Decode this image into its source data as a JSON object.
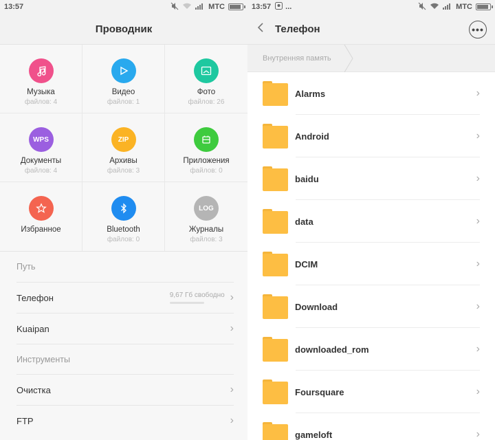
{
  "status_left": {
    "time": "13:57",
    "carrier": "МТС"
  },
  "status_right": {
    "time": "13:57",
    "carrier": "МТС",
    "notification_dots": "..."
  },
  "left": {
    "title": "Проводник",
    "categories": [
      {
        "label": "Музыка",
        "count": "файлов: 4",
        "color": "#f0518b",
        "icon": "music-icon",
        "glyph": "♫"
      },
      {
        "label": "Видео",
        "count": "файлов: 1",
        "color": "#29a9ee",
        "icon": "play-icon",
        "glyph": "▷"
      },
      {
        "label": "Фото",
        "count": "файлов: 26",
        "color": "#1ec8a0",
        "icon": "image-icon",
        "glyph": "▭"
      },
      {
        "label": "Документы",
        "count": "файлов: 4",
        "color": "#9b5fe0",
        "icon": "wps-icon",
        "glyph": "WPS"
      },
      {
        "label": "Архивы",
        "count": "файлов: 3",
        "color": "#fbb324",
        "icon": "zip-icon",
        "glyph": "ZIP"
      },
      {
        "label": "Приложения",
        "count": "файлов: 0",
        "color": "#3ecb3e",
        "icon": "apps-icon",
        "glyph": "⊟"
      },
      {
        "label": "Избранное",
        "count": "",
        "color": "#f46450",
        "icon": "star-icon",
        "glyph": "☆"
      },
      {
        "label": "Bluetooth",
        "count": "файлов: 0",
        "color": "#1f8cf0",
        "icon": "bluetooth-icon",
        "glyph": "ᛒ"
      },
      {
        "label": "Журналы",
        "count": "файлов: 3",
        "color": "#b5b5b5",
        "icon": "log-icon",
        "glyph": "LOG"
      }
    ],
    "path_header": "Путь",
    "path_items": [
      {
        "label": "Телефон",
        "storage_text": "9,67 Гб свободно",
        "used_fraction": 0.22
      },
      {
        "label": "Kuaipan"
      }
    ],
    "tools_header": "Инструменты",
    "tool_items": [
      {
        "label": "Очистка"
      },
      {
        "label": "FTP"
      }
    ]
  },
  "right": {
    "title": "Телефон",
    "breadcrumb": "Внутренняя память",
    "folders": [
      "Alarms",
      "Android",
      "baidu",
      "data",
      "DCIM",
      "Download",
      "downloaded_rom",
      "Foursquare",
      "gameloft"
    ]
  },
  "colors": {
    "folder": "#fdbe43",
    "storage_bar": "#ff6a19"
  }
}
